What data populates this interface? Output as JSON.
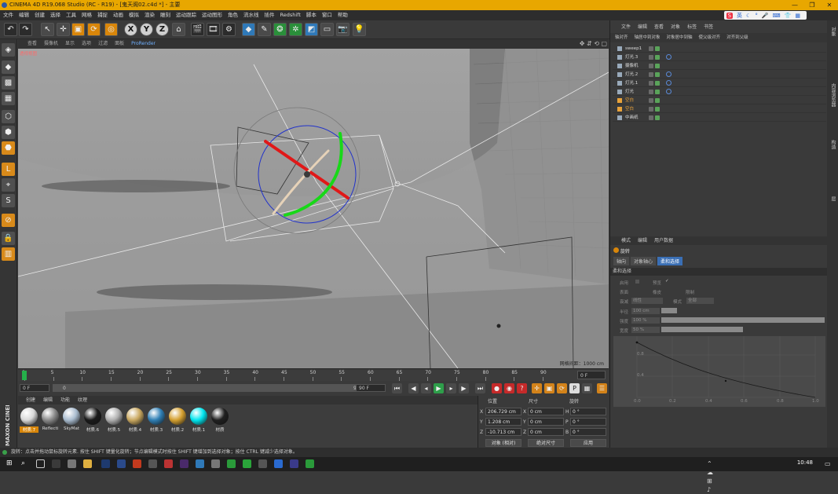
{
  "window": {
    "title": "CINEMA 4D R19.068 Studio (RC - R19) - [鬼天阁02.c4d *] - 主要",
    "controls": [
      "—",
      "❐",
      "✕"
    ]
  },
  "menu": [
    "文件",
    "编辑",
    "创建",
    "选择",
    "工具",
    "网格",
    "捕捉",
    "动画",
    "模拟",
    "渲染",
    "雕刻",
    "运动跟踪",
    "运动图形",
    "角色",
    "流水线",
    "插件",
    "Redshift",
    "脚本",
    "窗口",
    "帮助"
  ],
  "ime": {
    "logo": "S",
    "lang": "英"
  },
  "toolbar": {
    "undo": "↶",
    "redo": "↷",
    "x": "X",
    "y": "Y",
    "z": "Z"
  },
  "viewport": {
    "menu": [
      "查看",
      "摄像机",
      "显示",
      "选项",
      "过滤",
      "面板",
      "ProRender"
    ],
    "label": "透视视图",
    "grid_info": "网格间距：1000 cm"
  },
  "timeline": {
    "ticks": [
      "0",
      "5",
      "10",
      "15",
      "20",
      "25",
      "30",
      "35",
      "40",
      "45",
      "50",
      "55",
      "60",
      "65",
      "70",
      "75",
      "80",
      "85",
      "90"
    ],
    "current_frame": "0 F"
  },
  "playback": {
    "start": "0 F",
    "slider_start": "0",
    "slider_end": "90 F",
    "end": "90 F"
  },
  "material_menu": [
    "创建",
    "编辑",
    "功能",
    "纹理"
  ],
  "materials": [
    {
      "name": "材质.7",
      "color": "#d8d8d8",
      "selected": true
    },
    {
      "name": "Reflecti",
      "color": "#8a8a8a",
      "selected": false
    },
    {
      "name": "SkyMat",
      "color": "#a9bccf",
      "selected": false
    },
    {
      "name": "材质.6",
      "color": "#1a1a1a",
      "selected": false
    },
    {
      "name": "材质.5",
      "color": "#b0b0b0",
      "selected": false
    },
    {
      "name": "材质.4",
      "color": "#c9a860",
      "selected": false
    },
    {
      "name": "材质.3",
      "color": "#2f7fb5",
      "selected": false
    },
    {
      "name": "材质.2",
      "color": "#d4a030",
      "selected": false
    },
    {
      "name": "材质.1",
      "color": "#00e5ee",
      "selected": false
    },
    {
      "name": "材质",
      "color": "#202020",
      "selected": false
    }
  ],
  "coordinates": {
    "headers": [
      "位置",
      "尺寸",
      "旋转"
    ],
    "rows": [
      {
        "axis": "X",
        "pos": "206.729 cm",
        "size_axis": "X",
        "size": "0 cm",
        "rot_axis": "H",
        "rot": "0 °"
      },
      {
        "axis": "Y",
        "pos": "1.208 cm",
        "size_axis": "Y",
        "size": "0 cm",
        "rot_axis": "P",
        "rot": "0 °"
      },
      {
        "axis": "Z",
        "pos": "-10.713 cm",
        "size_axis": "Z",
        "size": "0 cm",
        "rot_axis": "B",
        "rot": "0 °"
      }
    ],
    "mode": "对象 (相对)",
    "size_mode": "绝对尺寸",
    "apply": "应用"
  },
  "object_manager": {
    "tabs": [
      "文件",
      "编辑",
      "查看",
      "对象",
      "标签",
      "书签"
    ],
    "commands": [
      "轴对齐",
      "轴居中到对象",
      "对象居中到轴",
      "使父级对齐",
      "对齐到父级"
    ],
    "objects": [
      {
        "name": "sweep1",
        "color": "normal",
        "tag": false
      },
      {
        "name": "灯光.3",
        "color": "normal",
        "tag": true
      },
      {
        "name": "摄像机",
        "color": "normal",
        "tag": false
      },
      {
        "name": "灯光.2",
        "color": "normal",
        "tag": true
      },
      {
        "name": "灯光.1",
        "color": "normal",
        "tag": true
      },
      {
        "name": "灯光",
        "color": "normal",
        "tag": true
      },
      {
        "name": "空白",
        "color": "orange",
        "tag": false
      },
      {
        "name": "空白",
        "color": "orange",
        "tag": false
      },
      {
        "name": "中画纸",
        "color": "normal",
        "tag": false
      }
    ]
  },
  "attributes": {
    "tabs": [
      "模式",
      "编辑",
      "用户数据"
    ],
    "title": "旋转",
    "subtabs": [
      "轴向",
      "对象轴心",
      "柔和选择"
    ],
    "section": "柔和选择",
    "fields": {
      "enable": "启用",
      "preview": "预览",
      "surface": "表面",
      "rubber": "橡皮",
      "restrict": "限制",
      "mode_label": "衰减",
      "mode_value": "线性",
      "mode2_label": "模式",
      "mode2_value": "全部",
      "radius_label": "半径",
      "radius_value": "100 cm",
      "strength_label": "强度",
      "strength_value": "100 %",
      "width_label": "宽度",
      "width_value": "50 %"
    },
    "graph_x": [
      "0.0",
      "0.2",
      "0.4",
      "0.6",
      "0.8",
      "1.0"
    ],
    "graph_y": [
      "0.8",
      "0.4"
    ]
  },
  "side_tabs": [
    "对象",
    "内容浏览器",
    "构造",
    "层"
  ],
  "status": "旋转：点击并拖动鼠标旋转元素. 按住 SHIFT 键量化旋转；节点编辑模式时按住 SHIFT 键增加到选择对象；按住 CTRL 键减少选择对象。",
  "taskbar": {
    "time": "10:48"
  },
  "brand": "MAXON CINEMA 4D"
}
